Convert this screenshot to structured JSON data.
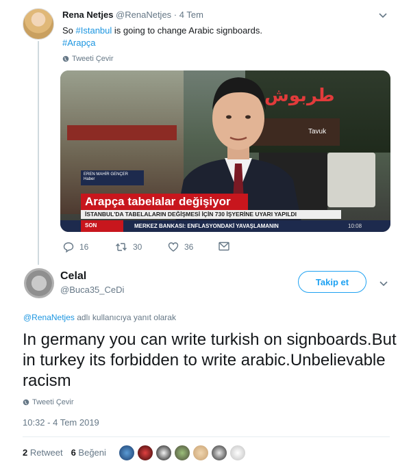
{
  "parent": {
    "name": "Rena Netjes",
    "handle": "@RenaNetjes",
    "dot": "·",
    "date": "4 Tem",
    "text_pre": "So ",
    "hashtag1": "#Istanbul",
    "text_post": " is going to change Arabic signboards.",
    "hashtag2": "#Arapça",
    "translate": "Tweeti Çevir",
    "media": {
      "reporter_name": "EREN MAHİR GENÇER",
      "reporter_role": "Haber",
      "headline": "Arapça tabelalar değişiyor",
      "subhead": "İSTANBUL'DA TABELALARIN DEĞİŞMESİ İÇİN 730 İŞYERİNE UYARI YAPILDI",
      "ticker_label": "SON",
      "ticker_text": "MERKEZ BANKASI: ENFLASYONDAKİ YAVAŞLAMANIN",
      "clock": "10:08",
      "sign_arabic": "طربوش",
      "sign_brand": "Tavuk"
    },
    "actions": {
      "replies": "16",
      "retweets": "30",
      "likes": "36"
    }
  },
  "reply": {
    "name": "Celal",
    "handle": "@Buca35_CeDi",
    "follow_label": "Takip et",
    "replying_handle": "@RenaNetjes",
    "replying_suffix": " adlı kullanıcıya yanıt olarak",
    "text": "In germany you can write turkish on signboards.But in turkey its forbidden to write arabic.Unbelievable racism",
    "translate": "Tweeti Çevir",
    "timestamp": "10:32 - 4 Tem 2019",
    "retweet_count": "2",
    "retweet_label": "Retweet",
    "like_count": "6",
    "like_label": "Beğeni"
  },
  "colors": {
    "link": "#1b95e0",
    "accent": "#1da1f2",
    "muted": "#657786",
    "headline_red": "#c8161d",
    "ticker_navy": "#1d2a4d"
  }
}
